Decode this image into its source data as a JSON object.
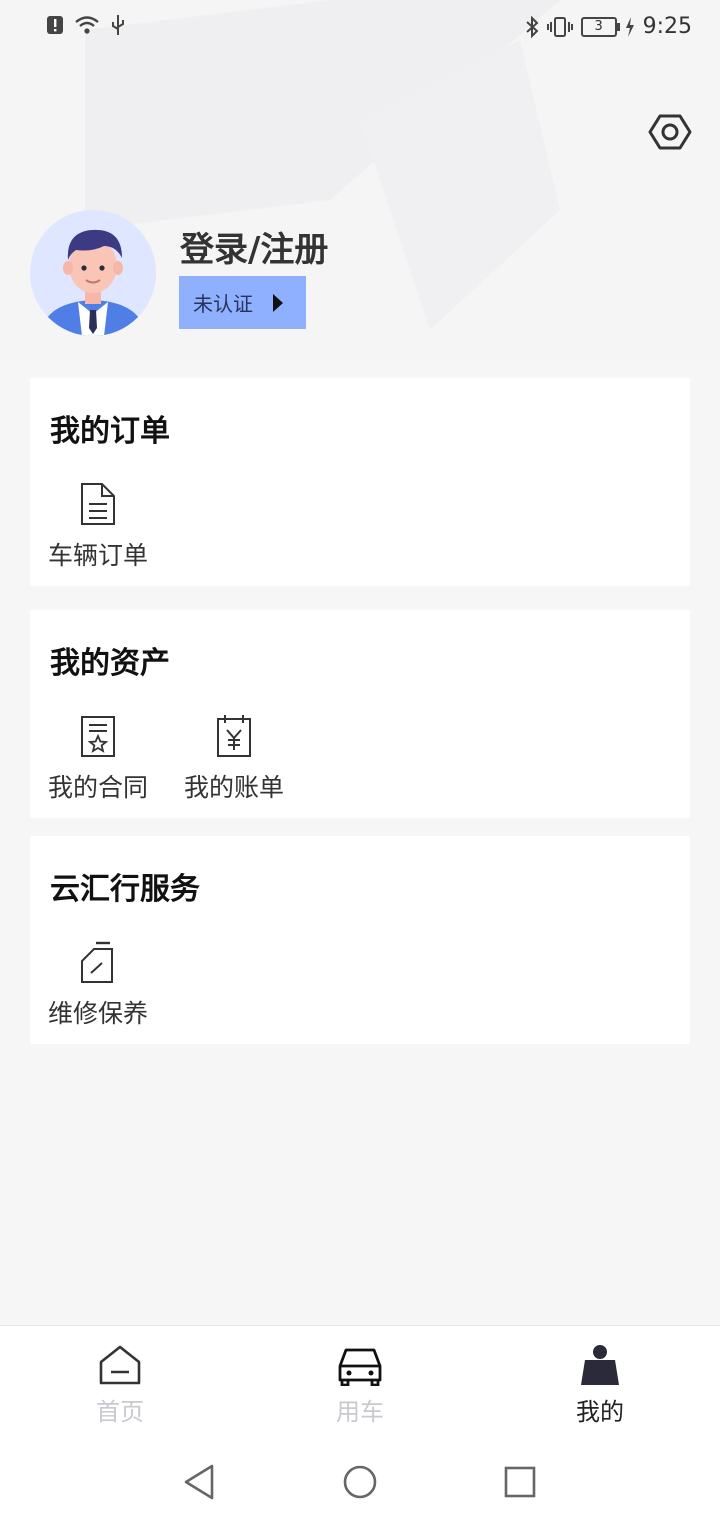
{
  "status_bar": {
    "time": "9:25",
    "battery_level": "3",
    "left_icons": [
      "alert-icon",
      "wifi-icon",
      "usb-icon"
    ],
    "right_icons": [
      "bluetooth-icon",
      "vibrate-icon",
      "battery-icon",
      "charging-icon"
    ]
  },
  "header": {
    "settings_icon": "settings-hexagon-icon"
  },
  "profile": {
    "login_text": "登录/注册",
    "auth_status": "未认证"
  },
  "sections": {
    "orders": {
      "title": "我的订单",
      "items": [
        {
          "label": "车辆订单",
          "icon": "document-icon"
        }
      ]
    },
    "assets": {
      "title": "我的资产",
      "items": [
        {
          "label": "我的合同",
          "icon": "contract-star-icon"
        },
        {
          "label": "我的账单",
          "icon": "bill-yen-icon"
        }
      ]
    },
    "services": {
      "title": "云汇行服务",
      "items": [
        {
          "label": "维修保养",
          "icon": "maintenance-oil-icon"
        }
      ]
    }
  },
  "tabbar": {
    "tabs": [
      {
        "label": "首页",
        "icon": "home-icon",
        "active": false
      },
      {
        "label": "用车",
        "icon": "car-icon",
        "active": false
      },
      {
        "label": "我的",
        "icon": "profile-icon",
        "active": true
      }
    ]
  },
  "nav_buttons": [
    "back-icon",
    "home-circle-icon",
    "recents-square-icon"
  ],
  "colors": {
    "badge_bg": "#8fb0ff",
    "page_bg": "#f6f6f7",
    "card_bg": "#ffffff",
    "tab_inactive": "#c9c9cf"
  }
}
